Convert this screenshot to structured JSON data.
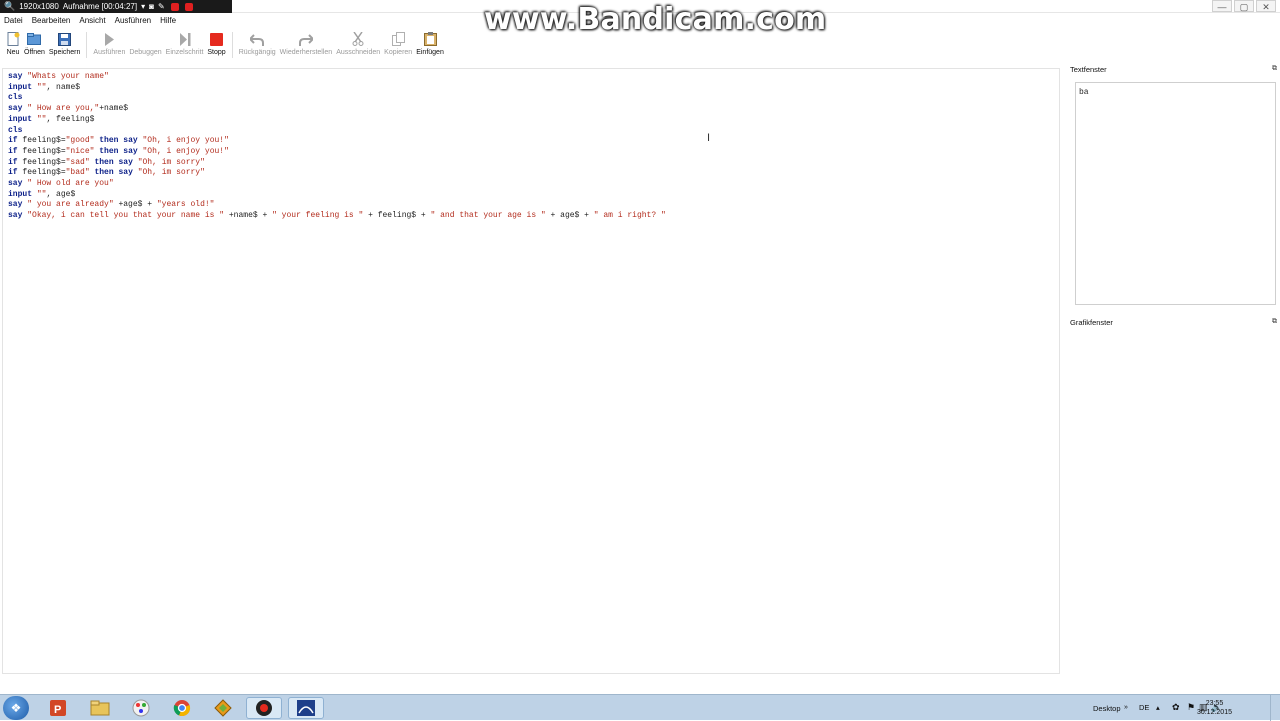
{
  "recording_bar": {
    "resolution": "1920x1080",
    "status": "Aufnahme [00:04:27]"
  },
  "watermark": "www.Bandicam.com",
  "window_controls": {
    "minimize": "—",
    "maximize": "▢",
    "close": "✕"
  },
  "menu": [
    "Datei",
    "Bearbeiten",
    "Ansicht",
    "Ausführen",
    "Hilfe"
  ],
  "toolbar": {
    "new": "Neu",
    "open": "Öffnen",
    "save": "Speichern",
    "run": "Ausführen",
    "debug": "Debuggen",
    "step": "Einzelschritt",
    "stop": "Stopp",
    "undo": "Rückgängig",
    "redo": "Wiederherstellen",
    "cut": "Ausschneiden",
    "copy": "Kopieren",
    "paste": "Einfügen"
  },
  "code": [
    [
      {
        "t": "say",
        "c": "kw"
      },
      {
        "t": " ",
        "c": ""
      },
      {
        "t": "\"Whats your name\"",
        "c": "str"
      }
    ],
    [
      {
        "t": "input",
        "c": "kw"
      },
      {
        "t": " ",
        "c": ""
      },
      {
        "t": "\"\"",
        "c": "str"
      },
      {
        "t": ", name$",
        "c": ""
      }
    ],
    [
      {
        "t": "cls",
        "c": "kw"
      }
    ],
    [
      {
        "t": "say",
        "c": "kw"
      },
      {
        "t": " ",
        "c": ""
      },
      {
        "t": "\" How are you,\"",
        "c": "str"
      },
      {
        "t": "+name$",
        "c": ""
      }
    ],
    [
      {
        "t": "input",
        "c": "kw"
      },
      {
        "t": " ",
        "c": ""
      },
      {
        "t": "\"\"",
        "c": "str"
      },
      {
        "t": ", feeling$",
        "c": ""
      }
    ],
    [
      {
        "t": "cls",
        "c": "kw"
      }
    ],
    [
      {
        "t": "if",
        "c": "kw"
      },
      {
        "t": " feeling$=",
        "c": ""
      },
      {
        "t": "\"good\"",
        "c": "str"
      },
      {
        "t": " ",
        "c": ""
      },
      {
        "t": "then",
        "c": "kw"
      },
      {
        "t": " ",
        "c": ""
      },
      {
        "t": "say",
        "c": "kw"
      },
      {
        "t": " ",
        "c": ""
      },
      {
        "t": "\"Oh, i enjoy you!\"",
        "c": "str"
      }
    ],
    [
      {
        "t": "if",
        "c": "kw"
      },
      {
        "t": " feeling$=",
        "c": ""
      },
      {
        "t": "\"nice\"",
        "c": "str"
      },
      {
        "t": " ",
        "c": ""
      },
      {
        "t": "then",
        "c": "kw"
      },
      {
        "t": " ",
        "c": ""
      },
      {
        "t": "say",
        "c": "kw"
      },
      {
        "t": " ",
        "c": ""
      },
      {
        "t": "\"Oh, i enjoy you!\"",
        "c": "str"
      }
    ],
    [
      {
        "t": "if",
        "c": "kw"
      },
      {
        "t": " feeling$=",
        "c": ""
      },
      {
        "t": "\"sad\"",
        "c": "str"
      },
      {
        "t": " ",
        "c": ""
      },
      {
        "t": "then",
        "c": "kw"
      },
      {
        "t": " ",
        "c": ""
      },
      {
        "t": "say",
        "c": "kw"
      },
      {
        "t": " ",
        "c": ""
      },
      {
        "t": "\"Oh, im sorry\"",
        "c": "str"
      }
    ],
    [
      {
        "t": "if",
        "c": "kw"
      },
      {
        "t": " feeling$=",
        "c": ""
      },
      {
        "t": "\"bad\"",
        "c": "str"
      },
      {
        "t": " ",
        "c": ""
      },
      {
        "t": "then",
        "c": "kw"
      },
      {
        "t": " ",
        "c": ""
      },
      {
        "t": "say",
        "c": "kw"
      },
      {
        "t": " ",
        "c": ""
      },
      {
        "t": "\"Oh, im sorry\"",
        "c": "str"
      }
    ],
    [
      {
        "t": "say",
        "c": "kw"
      },
      {
        "t": " ",
        "c": ""
      },
      {
        "t": "\" How old are you\"",
        "c": "str"
      }
    ],
    [
      {
        "t": "input",
        "c": "kw"
      },
      {
        "t": " ",
        "c": ""
      },
      {
        "t": "\"\"",
        "c": "str"
      },
      {
        "t": ", age$",
        "c": ""
      }
    ],
    [
      {
        "t": "say",
        "c": "kw"
      },
      {
        "t": " ",
        "c": ""
      },
      {
        "t": "\" you are already\"",
        "c": "str"
      },
      {
        "t": " +age$ + ",
        "c": ""
      },
      {
        "t": "\"years old!\"",
        "c": "str"
      }
    ],
    [
      {
        "t": "say",
        "c": "kw"
      },
      {
        "t": " ",
        "c": ""
      },
      {
        "t": "\"Okay, i can tell you that your name is \"",
        "c": "str"
      },
      {
        "t": " +name$ + ",
        "c": ""
      },
      {
        "t": "\" your feeling is \"",
        "c": "str"
      },
      {
        "t": " + feeling$ + ",
        "c": ""
      },
      {
        "t": "\" and that your age is \"",
        "c": "str"
      },
      {
        "t": " + age$ + ",
        "c": ""
      },
      {
        "t": "\" am i right? \"",
        "c": "str"
      }
    ]
  ],
  "text_panel": {
    "title": "Textfenster",
    "output": "ba",
    "float_icon": "⧉"
  },
  "graphics_panel": {
    "title": "Grafikfenster",
    "float_icon": "⧉"
  },
  "taskbar": {
    "desktop_label": "Desktop",
    "language": "DE",
    "time": "23:55",
    "date": "30.12.2015",
    "apps": [
      "start",
      "powerpoint",
      "explorer",
      "paint",
      "chrome",
      "app-diamond",
      "recorder",
      "basic-256"
    ]
  }
}
